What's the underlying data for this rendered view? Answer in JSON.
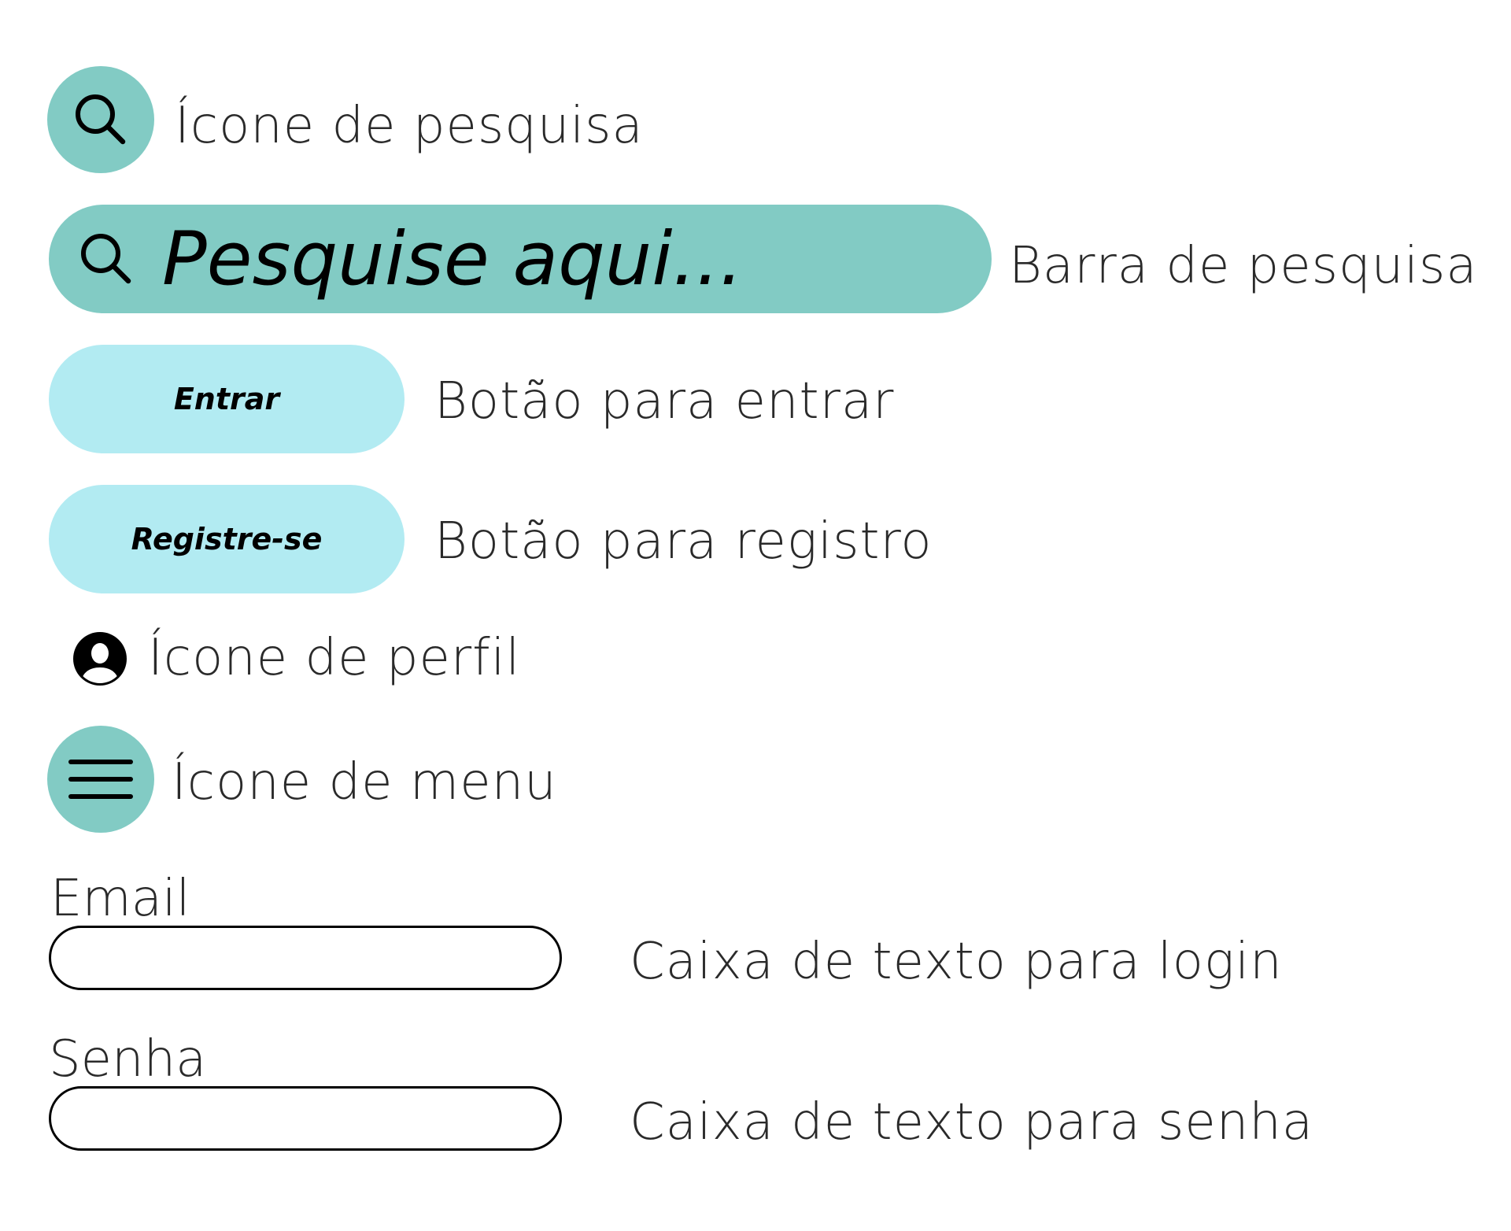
{
  "items": {
    "search_icon": {
      "icon": "search-icon",
      "caption": "Ícone de pesquisa"
    },
    "search_bar": {
      "icon": "search-icon",
      "placeholder": "Pesquise aqui...",
      "caption": "Barra de pesquisa"
    },
    "login_button": {
      "label": "Entrar",
      "caption": "Botão para entrar"
    },
    "register_button": {
      "label": "Registre-se",
      "caption": "Botão para registro"
    },
    "profile_icon": {
      "icon": "user-profile-icon",
      "caption": "Ícone de perfil"
    },
    "menu_icon": {
      "icon": "hamburger-menu-icon",
      "caption": "Ícone de menu"
    },
    "email_field": {
      "label": "Email",
      "value": "",
      "caption": "Caixa de texto para login"
    },
    "password_field": {
      "label": "Senha",
      "value": "",
      "caption": "Caixa de texto para senha"
    }
  },
  "colors": {
    "teal": "#82CBC4",
    "light_cyan": "#B2EBF2",
    "text": "#000000"
  }
}
